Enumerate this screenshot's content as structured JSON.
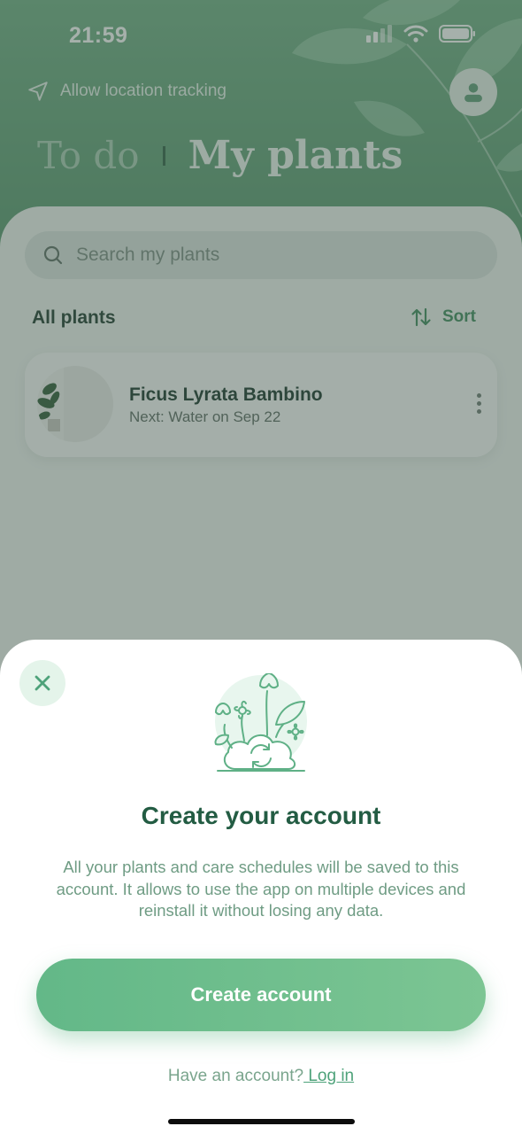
{
  "status_bar": {
    "time": "21:59"
  },
  "header": {
    "location_label": "Allow location tracking",
    "tabs": [
      {
        "label": "To do",
        "active": false
      },
      {
        "label": "My plants",
        "active": true
      }
    ]
  },
  "search": {
    "placeholder": "Search my plants"
  },
  "list": {
    "section_label": "All plants",
    "sort_label": "Sort",
    "plants": [
      {
        "name": "Ficus Lyrata Bambino",
        "next": "Next: Water on Sep 22"
      }
    ]
  },
  "sheet": {
    "title": "Create your account",
    "description": "All your plants and care schedules will be saved to this account. It allows to use the app on multiple devices and reinstall it without losing any data.",
    "primary_button": "Create account",
    "login_prompt": "Have an account?",
    "login_link": " Log in"
  },
  "colors": {
    "brand_green": "#63b888",
    "title_green": "#235c43",
    "text_muted": "#6f9c84"
  },
  "icons": [
    "navigation-arrow-icon",
    "user-icon",
    "search-icon",
    "sort-arrows-icon",
    "more-vertical-icon",
    "close-icon",
    "plants-sync-illustration"
  ]
}
